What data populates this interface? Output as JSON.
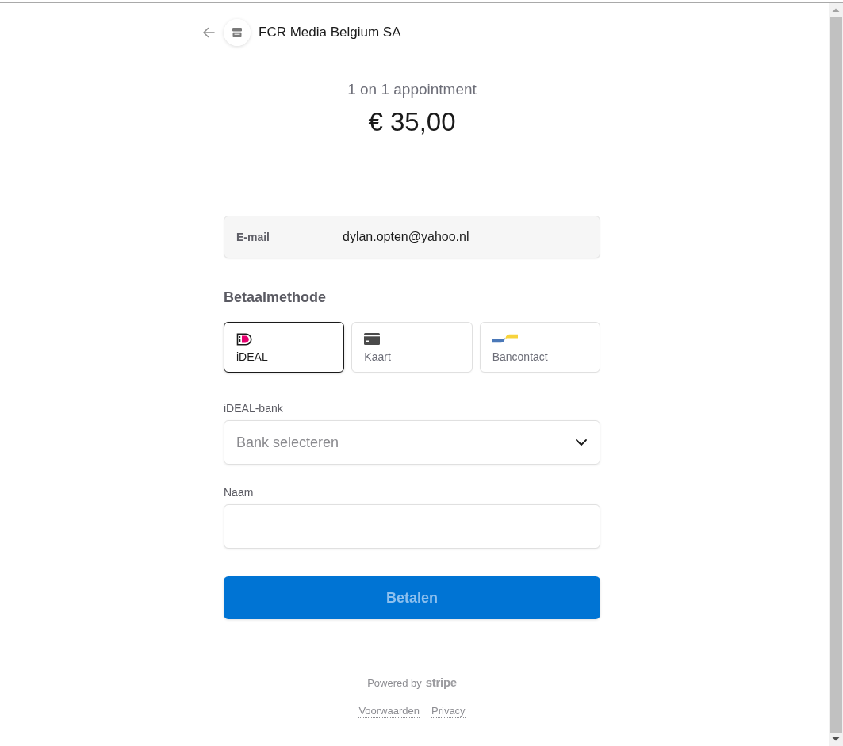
{
  "merchant": {
    "name": "FCR Media Belgium SA"
  },
  "product": {
    "name": "1 on 1 appointment",
    "price": "€ 35,00"
  },
  "email": {
    "label": "E-mail",
    "value": "dylan.opten@yahoo.nl"
  },
  "payment_method": {
    "heading": "Betaalmethode",
    "options": [
      {
        "kind": "ideal",
        "label": "iDEAL",
        "selected": true
      },
      {
        "kind": "card",
        "label": "Kaart",
        "selected": false
      },
      {
        "kind": "bancontact",
        "label": "Bancontact",
        "selected": false
      }
    ]
  },
  "bank_select": {
    "label": "iDEAL-bank",
    "placeholder": "Bank selecteren"
  },
  "name_field": {
    "label": "Naam"
  },
  "pay_button": {
    "label": "Betalen",
    "disabled": true
  },
  "footer": {
    "powered_by": "Powered by",
    "brand": "stripe",
    "links": [
      "Voorwaarden",
      "Privacy"
    ]
  }
}
